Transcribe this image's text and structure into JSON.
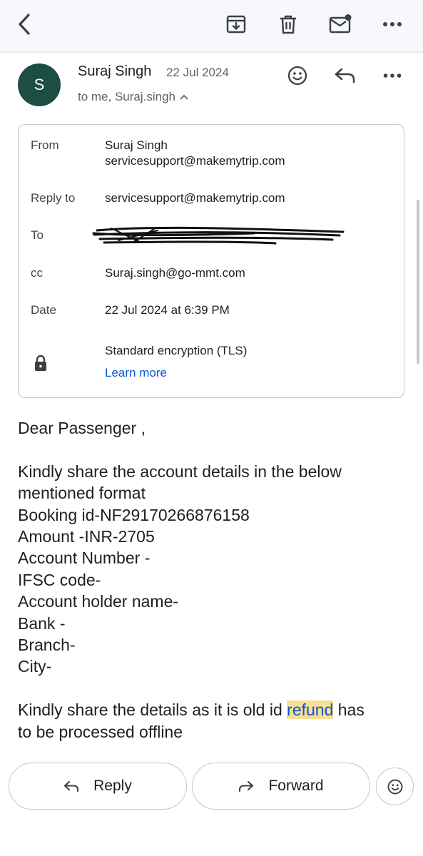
{
  "toolbar": {
    "back_icon": "chevron-left-icon",
    "archive_icon": "archive-icon",
    "delete_icon": "trash-icon",
    "mark_unread_icon": "mail-unread-icon",
    "more_icon": "more-horizontal-icon"
  },
  "message": {
    "avatar_letter": "S",
    "avatar_color": "#1d4d43",
    "sender": "Suraj Singh",
    "date": "22 Jul 2024",
    "recipients": "to me, Suraj.singh"
  },
  "details": {
    "from_label": "From",
    "from_name": "Suraj Singh",
    "from_email": "servicesupport@makemytrip.com",
    "reply_to_label": "Reply to",
    "reply_to_value": "servicesupport@makemytrip.com",
    "to_label": "To",
    "cc_label": "cc",
    "cc_value": "Suraj.singh@go-mmt.com",
    "date_label": "Date",
    "date_value": "22 Jul 2024 at 6:39 PM",
    "encryption": "Standard encryption (TLS)",
    "learn_more": "Learn more"
  },
  "body": {
    "greeting": "Dear Passenger ,",
    "lines": [
      "Kindly share the account details in the below",
      "mentioned format",
      "Booking id-NF29170266876158",
      "Amount -INR-2705",
      "Account Number -",
      "IFSC code-",
      "Account holder name-",
      "Bank -",
      "Branch-",
      "City-"
    ],
    "closing_prefix": "Kindly share the details as it is old id ",
    "closing_highlight": "refund",
    "closing_suffix": " has",
    "closing_line2": "to be processed offline"
  },
  "actions": {
    "reply": "Reply",
    "forward": "Forward"
  },
  "colors": {
    "accent": "#0b57d0",
    "highlight": "#f7df96",
    "toolbar_bg": "#f6f8fc"
  }
}
